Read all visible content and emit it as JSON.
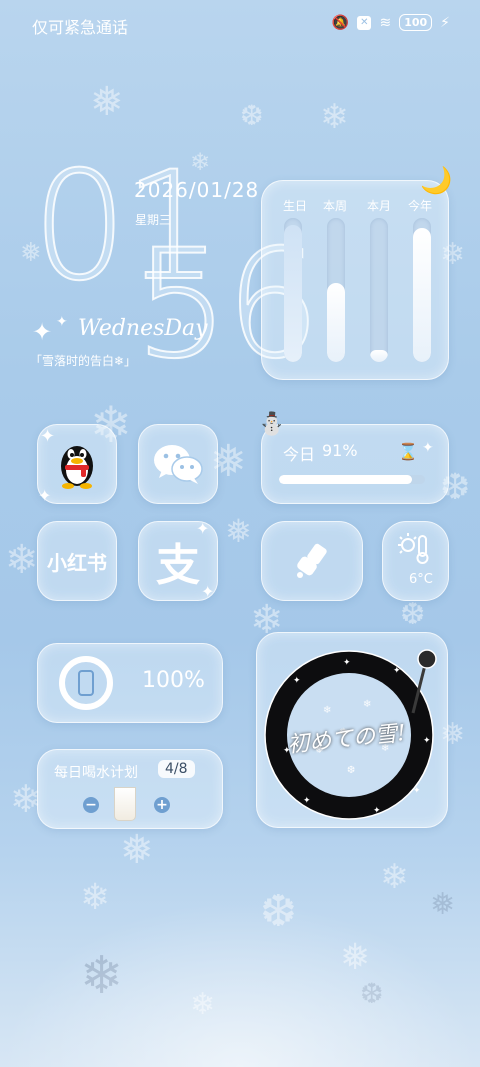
{
  "status_bar": {
    "carrier": "仅可紧急通话",
    "battery": "100"
  },
  "clock": {
    "hour": "01",
    "minute": "56",
    "date": "2026/01/28",
    "weekday": "星期三",
    "script_text": "WednesDay",
    "caption": "「雪落时的告白❄」"
  },
  "progress_widget": {
    "labels": [
      "生日",
      "本周",
      "本月",
      "今年"
    ],
    "fractions": [
      0.95,
      0.55,
      0.08,
      0.93
    ]
  },
  "apps": [
    {
      "name": "QQ",
      "icon": "penguin-icon"
    },
    {
      "name": "WeChat",
      "icon": "chat-bubbles-icon"
    },
    {
      "name": "小红书",
      "label": "小红书"
    },
    {
      "name": "Alipay",
      "label": "支"
    }
  ],
  "today_widget": {
    "label": "今日",
    "percent_text": "91%",
    "percent": 0.91
  },
  "weather": {
    "temperature": "6°C",
    "icon": "thermometer-sun-icon"
  },
  "battery_widget": {
    "percent_text": "100%",
    "percent": 1.0
  },
  "water_plan": {
    "title": "每日喝水计划",
    "count": "4/8",
    "minus": "−",
    "plus": "+"
  },
  "record_widget": {
    "script_text": "初めての雪!"
  },
  "colors": {
    "accent_blue": "#6f9fd0",
    "glass_border": "#ffffff"
  }
}
